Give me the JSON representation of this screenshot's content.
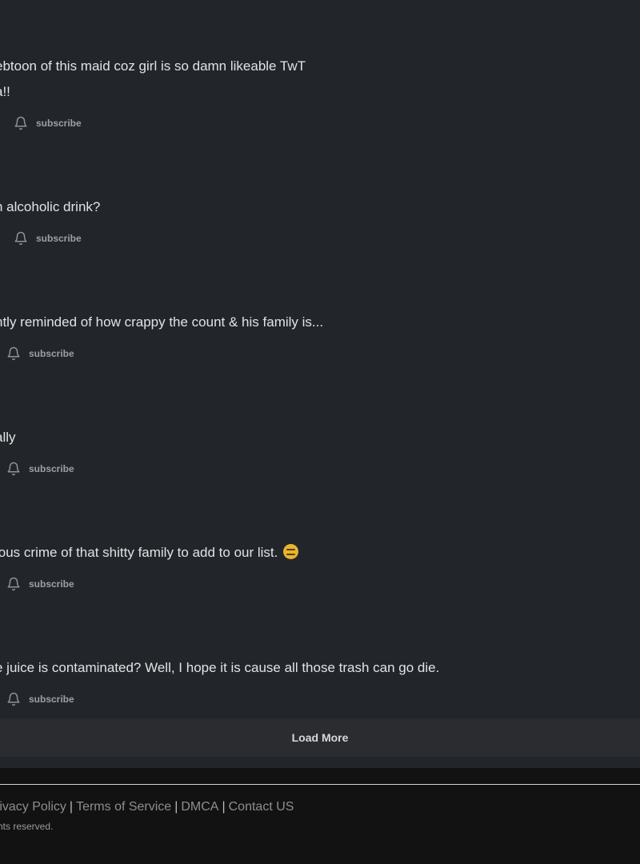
{
  "comments": [
    {
      "lines": [
        "ebtoon of this maid coz girl is so damn likeable TwT",
        "a!!"
      ],
      "subscribe_label": "subscribe"
    },
    {
      "lines": [
        "n alcoholic drink?"
      ],
      "subscribe_label": "subscribe"
    },
    {
      "lines": [
        "ntly reminded of how crappy the count & his family is..."
      ],
      "subscribe_label": "subscribe"
    },
    {
      "lines": [
        "ally"
      ],
      "subscribe_label": "subscribe"
    },
    {
      "lines": [
        "ious crime of that shitty family to add to our list."
      ],
      "emoji": "expressionless-face",
      "subscribe_label": "subscribe"
    },
    {
      "lines": [
        "e juice is contaminated? Well, I hope it is cause all those trash can go die."
      ],
      "subscribe_label": "subscribe"
    }
  ],
  "load_more": {
    "label": "Load More"
  },
  "footer": {
    "links": [
      "rivacy Policy",
      "Terms of Service",
      "DMCA",
      "Contact US"
    ],
    "separator": "|",
    "copyright": "hts reserved."
  },
  "colors": {
    "panel_bg": "#22262b",
    "page_bg": "#121212",
    "load_more_bg": "#2a2c2f",
    "muted_text": "#9aa0a6",
    "emoji_yellow": "#e7b62f"
  },
  "icons": {
    "subscribe": "bell-icon",
    "emoji": "expressionless-face-emoji"
  }
}
